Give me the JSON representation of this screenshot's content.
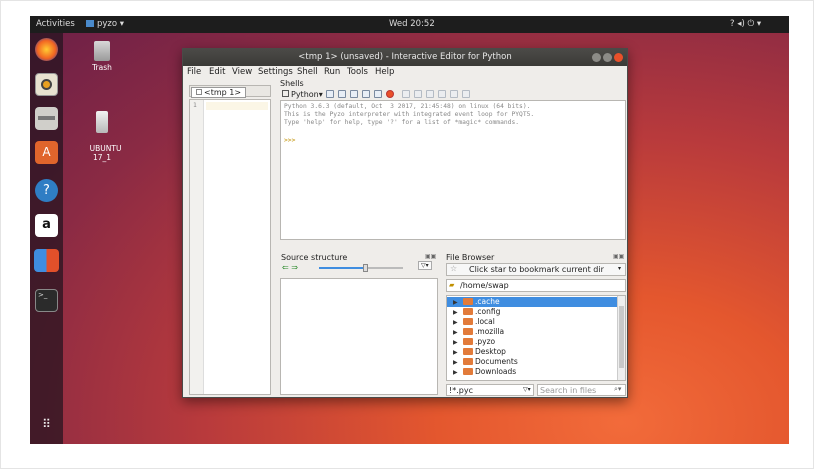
{
  "topbar": {
    "activities": "Activities",
    "app": "pyzo ▾",
    "clock": "Wed 20:52",
    "status": "? ◂) ⏻ ▾"
  },
  "desktop": {
    "trash": "Trash",
    "drive": "UBUNTU\n17_1"
  },
  "window": {
    "title": "<tmp 1> (unsaved) - Interactive Editor for Python"
  },
  "menu": [
    "File",
    "Edit",
    "View",
    "Settings",
    "Shell",
    "Run",
    "Tools",
    "Help"
  ],
  "editor": {
    "tab": "<tmp 1>",
    "line": "1"
  },
  "shells": {
    "label": "Shells",
    "tab": "Python",
    "output": "Python 3.6.3 (default, Oct  3 2017, 21:45:48) on linux (64 bits).\nThis is the Pyzo interpreter with integrated event loop for PYQT5.\nType 'help' for help, type '?' for a list of *magic* commands.",
    "prompt": ">>>"
  },
  "source": {
    "label": "Source structure"
  },
  "browser": {
    "label": "File Browser",
    "bookmark": "Click star to bookmark current dir",
    "path": "/home/swap",
    "items": [
      ".cache",
      ".config",
      ".local",
      ".mozilla",
      ".pyzo",
      "Desktop",
      "Documents",
      "Downloads"
    ],
    "filter": "!*.pyc",
    "search_placeholder": "Search in files"
  },
  "colors": {
    "accent": "#3f8de0",
    "folder": "#e27b3a",
    "close": "#e9502a"
  }
}
